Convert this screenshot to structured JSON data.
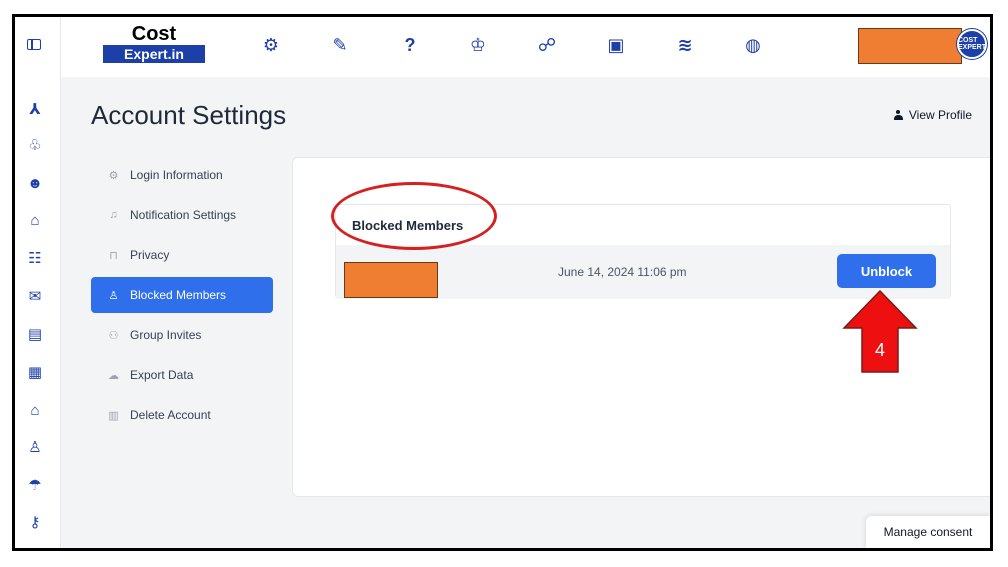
{
  "logo": {
    "top": "Cost",
    "bottom": "Expert.in"
  },
  "avatar": {
    "text": "COST EXPERT"
  },
  "page": {
    "title": "Account Settings",
    "view_profile": "View Profile"
  },
  "nav": [
    {
      "label": "Login Information",
      "icon": "gear-icon"
    },
    {
      "label": "Notification Settings",
      "icon": "bell-icon"
    },
    {
      "label": "Privacy",
      "icon": "lock-icon"
    },
    {
      "label": "Blocked Members",
      "icon": "user-block-icon",
      "active": true
    },
    {
      "label": "Group Invites",
      "icon": "group-icon"
    },
    {
      "label": "Export Data",
      "icon": "cloud-download-icon"
    },
    {
      "label": "Delete Account",
      "icon": "trash-icon"
    }
  ],
  "blocked": {
    "title": "Blocked Members",
    "row": {
      "date": "June 14, 2024 11:06 pm",
      "action": "Unblock"
    }
  },
  "annotation": {
    "number": "4"
  },
  "consent": "Manage consent",
  "colors": {
    "primary": "#2f6fec",
    "brand": "#1d3fa8",
    "redacted": "#ef7e32",
    "annotation": "#d42020"
  }
}
